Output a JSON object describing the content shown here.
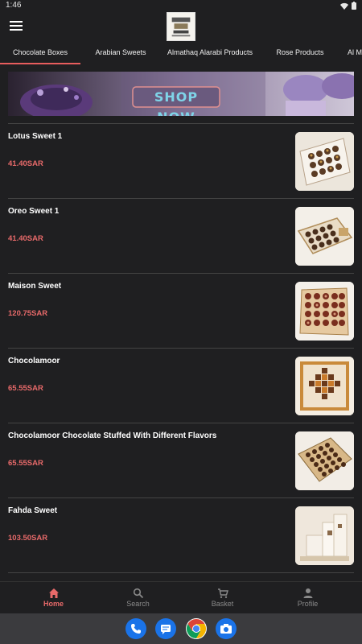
{
  "status": {
    "time": "1:46"
  },
  "header": {
    "menu_icon": "hamburger-icon",
    "logo_icon": "store-logo"
  },
  "tabs": [
    {
      "label": "Chocolate Boxes",
      "active": true
    },
    {
      "label": "Arabian Sweets",
      "active": false
    },
    {
      "label": "Almathaq Alarabi Products",
      "active": false
    },
    {
      "label": "Rose Products",
      "active": false
    },
    {
      "label": "Al M",
      "active": false
    }
  ],
  "banner": {
    "text": "SHOP NOW"
  },
  "products": [
    {
      "name": "Lotus Sweet 1",
      "price": "41.40SAR"
    },
    {
      "name": "Oreo Sweet 1",
      "price": "41.40SAR"
    },
    {
      "name": "Maison Sweet",
      "price": "120.75SAR"
    },
    {
      "name": "Chocolamoor",
      "price": "65.55SAR"
    },
    {
      "name": "Chocolamoor Chocolate Stuffed With Different Flavors",
      "price": "65.55SAR"
    },
    {
      "name": "Fahda Sweet",
      "price": "103.50SAR"
    }
  ],
  "nav": [
    {
      "label": "Home",
      "icon": "home-icon",
      "active": true
    },
    {
      "label": "Search",
      "icon": "search-icon",
      "active": false
    },
    {
      "label": "Basket",
      "icon": "cart-icon",
      "active": false
    },
    {
      "label": "Profile",
      "icon": "person-icon",
      "active": false
    }
  ],
  "dock": [
    {
      "icon": "phone-icon"
    },
    {
      "icon": "messages-icon"
    },
    {
      "icon": "chrome-icon"
    },
    {
      "icon": "camera-icon"
    }
  ],
  "colors": {
    "accent": "#e86a6a",
    "background": "#1f1f21",
    "banner_text": "#7fd4e8"
  }
}
